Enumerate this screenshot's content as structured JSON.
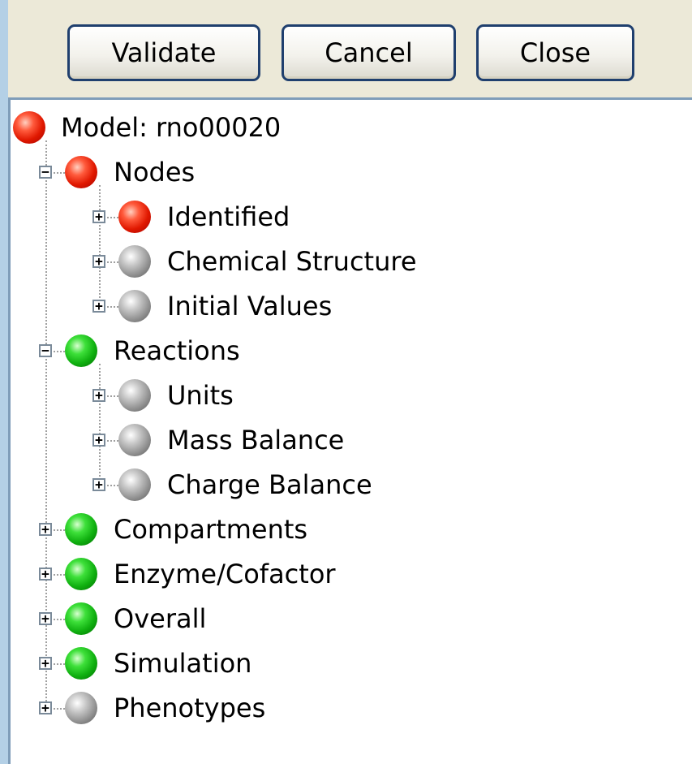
{
  "toolbar": {
    "validate_label": "Validate",
    "cancel_label": "Cancel",
    "close_label": "Close"
  },
  "tree": {
    "root": {
      "label": "Model: rno00020",
      "status": "red"
    },
    "nodes": {
      "label": "Nodes",
      "status": "red",
      "expander": "−",
      "children": [
        {
          "label": "Identified",
          "status": "red",
          "expander": "+"
        },
        {
          "label": "Chemical Structure",
          "status": "gray",
          "expander": "+"
        },
        {
          "label": "Initial Values",
          "status": "gray",
          "expander": "+"
        }
      ]
    },
    "reactions": {
      "label": "Reactions",
      "status": "green",
      "expander": "−",
      "children": [
        {
          "label": "Units",
          "status": "gray",
          "expander": "+"
        },
        {
          "label": "Mass Balance",
          "status": "gray",
          "expander": "+"
        },
        {
          "label": "Charge Balance",
          "status": "gray",
          "expander": "+"
        }
      ]
    },
    "top_items": [
      {
        "label": "Compartments",
        "status": "green",
        "expander": "+"
      },
      {
        "label": "Enzyme/Cofactor",
        "status": "green",
        "expander": "+"
      },
      {
        "label": "Overall",
        "status": "green",
        "expander": "+"
      },
      {
        "label": "Simulation",
        "status": "green",
        "expander": "+"
      },
      {
        "label": "Phenotypes",
        "status": "gray",
        "expander": "+"
      }
    ]
  },
  "colors": {
    "status_red": "#e01800",
    "status_green": "#10b010",
    "status_gray": "#8e8e8e",
    "button_border": "#1f3f6e",
    "panel_bg": "#ece9d8",
    "window_bg": "#b4d0e6"
  }
}
